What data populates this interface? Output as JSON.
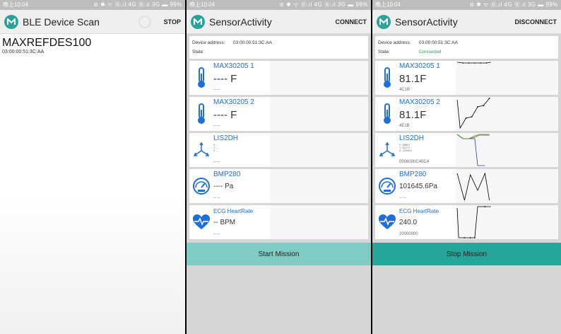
{
  "status_bar": {
    "time": "晚上10:04",
    "icons_s1": "⊘ ✱ ᯤ Ⓡ.ıl 4G Ⓡ.ıl 3G ▬ 99%",
    "icons": "⊘ ✱ ᯤ Ⓡ.ıl 4G Ⓡ.ıl 3G ▬ 99%"
  },
  "scan": {
    "title": "BLE Device Scan",
    "action": "STOP",
    "device_name": "MAXREFDES100",
    "device_address": "03:00:00:51:3C:AA"
  },
  "activity": {
    "title": "SensorActivity",
    "address_label": "Device address:",
    "address_value": "03:00:00:51:3C:AA",
    "state_label": "State:"
  },
  "left": {
    "action": "CONNECT",
    "state": "",
    "mission": "Start Mission",
    "cards": [
      {
        "name": "MAX30205 1",
        "value": "---- F",
        "sub": "-- --"
      },
      {
        "name": "MAX30205 2",
        "value": "---- F",
        "sub": "-- --"
      },
      {
        "name": "LIS2DH",
        "axes": [
          "X: --",
          "Y: --",
          "Z: --"
        ],
        "sub": "-- --"
      },
      {
        "name": "BMP280",
        "value": "---- Pa",
        "sub": "-- --"
      },
      {
        "name": "ECG HeartRate",
        "value": "-- BPM",
        "sub": "-- --"
      }
    ]
  },
  "right": {
    "action": "DISCONNECT",
    "state": "Connected",
    "mission": "Stop Mission",
    "cards": [
      {
        "name": "MAX30205 1",
        "value": "81.1F",
        "sub": "4C1B"
      },
      {
        "name": "MAX30205 2",
        "value": "81.1F",
        "sub": "4E1B"
      },
      {
        "name": "LIS2DH",
        "axes": [
          "X: 1586.0",
          "Y: 3072.0",
          "Z: -15196.0"
        ],
        "sub": "0006000C40C4"
      },
      {
        "name": "BMP280",
        "value": "101645.6Pa",
        "sub": "-- --"
      },
      {
        "name": "ECG HeartRate",
        "value": "240.0",
        "sub": "20000000"
      }
    ]
  },
  "colors": {
    "accent": "#26a69a",
    "accent_light": "#80cbc4",
    "link": "#1e6fd9",
    "connected": "#2aa34a"
  },
  "icons": [
    "thermometer-icon",
    "thermometer-icon",
    "axes-icon",
    "gauge-icon",
    "heart-pulse-icon"
  ]
}
